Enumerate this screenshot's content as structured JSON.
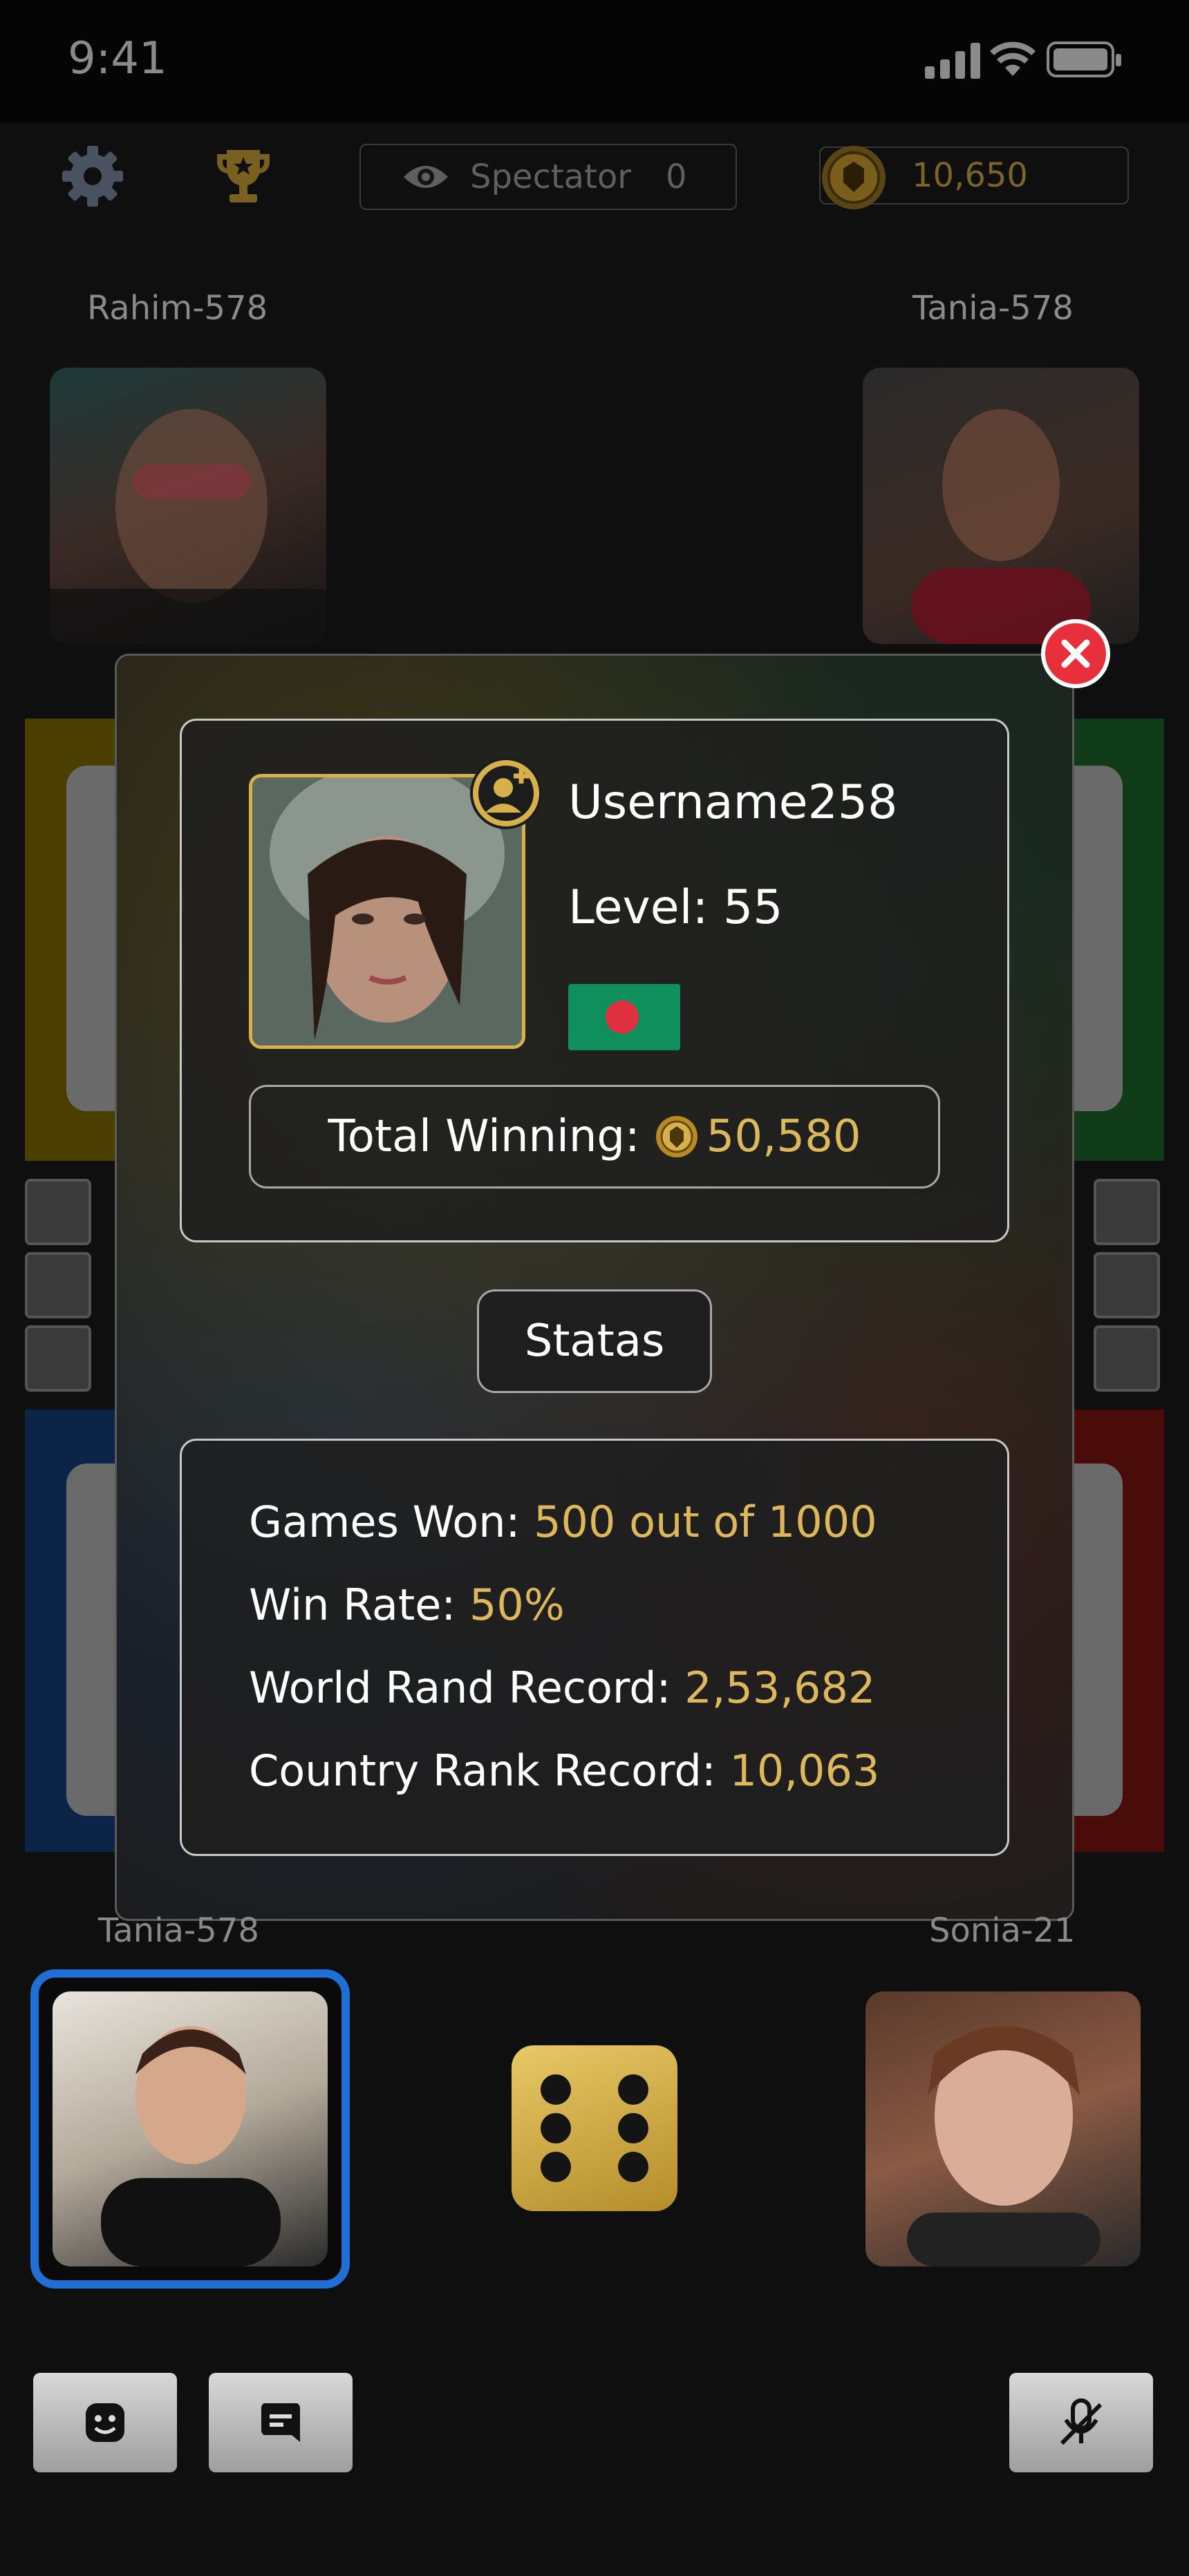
{
  "status_bar": {
    "time": "9:41"
  },
  "top_bar": {
    "spectator_label": "Spectator",
    "spectator_count": "0",
    "coins": "10,650"
  },
  "players": {
    "top_left": "Rahim-578",
    "top_right": "Tania-578",
    "bottom_left": "Tania-578",
    "bottom_right": "Sonia-21"
  },
  "profile": {
    "username": "Username258",
    "level": "Level: 55",
    "total_winning_label": "Total Winning:",
    "total_winning_value": "50,580"
  },
  "statas_button": "Statas",
  "stats": {
    "games_won_label": "Games Won: ",
    "games_won_value": "500 out of 1000",
    "win_rate_label": "Win Rate: ",
    "win_rate_value": "50%",
    "world_rank_label": "World Rand Record: ",
    "world_rank_value": "2,53,682",
    "country_rank_label": "Country Rank Record: ",
    "country_rank_value": "10,063"
  },
  "colors": {
    "accent_gold": "#dcb85b",
    "close_red": "#e8303d",
    "active_blue": "#1f6fd6"
  }
}
